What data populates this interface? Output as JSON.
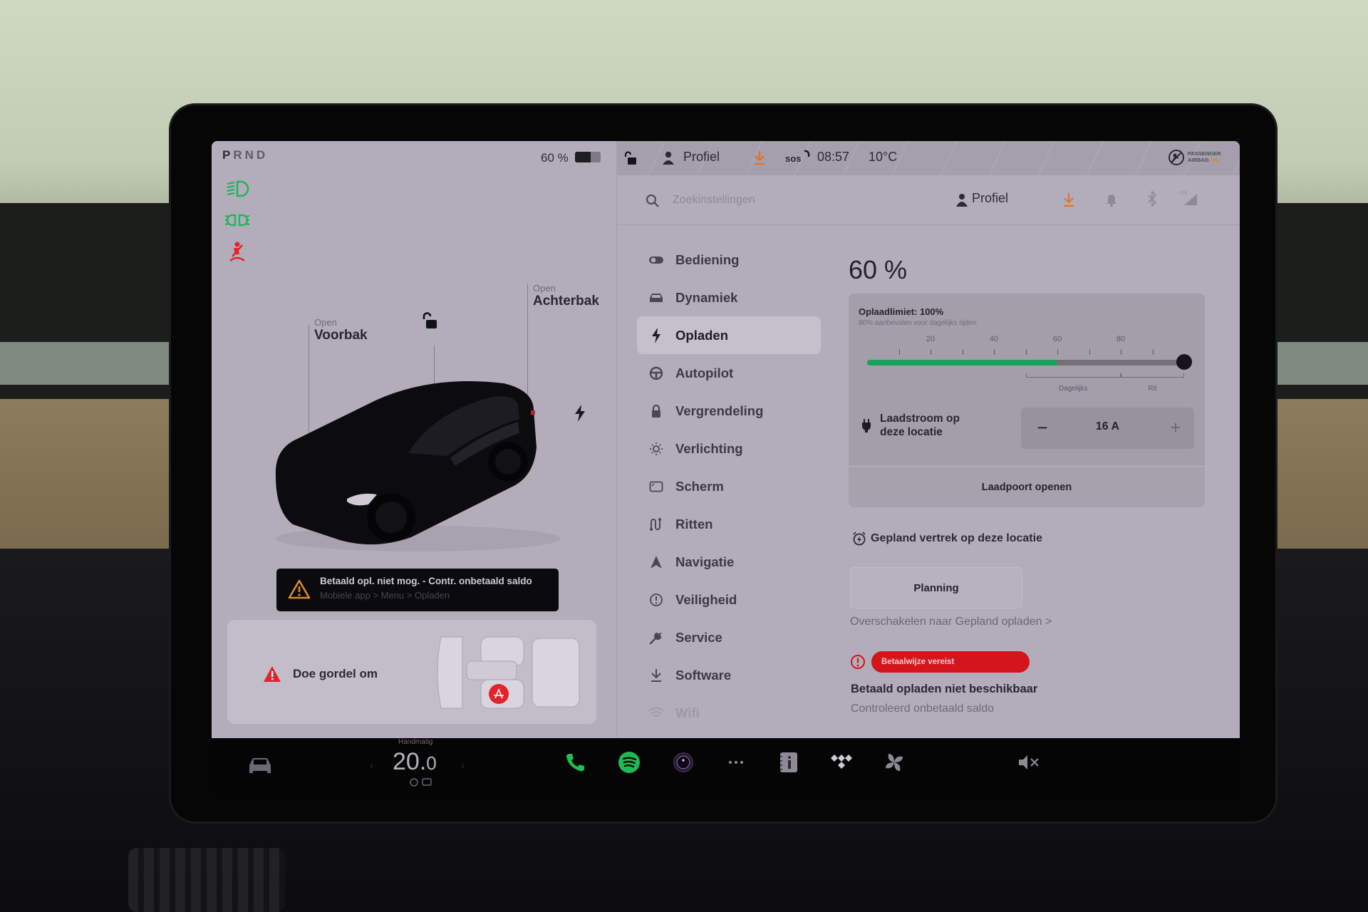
{
  "status_bar": {
    "gear": {
      "selected": "P",
      "others": "RND"
    },
    "battery_percent": "60 %",
    "battery_level": 0.6,
    "profile": "Profiel",
    "sos": "sos",
    "time": "08:57",
    "temperature": "10°C",
    "airbag": {
      "line1": "PASSENGER",
      "line2": "AIRBAG",
      "state": "ON"
    }
  },
  "telltales": [
    "low-beam-headlight",
    "parking-lights",
    "seatbelt-warning"
  ],
  "vehicle": {
    "frunk": {
      "state": "Open",
      "label": "Voorbak"
    },
    "trunk": {
      "state": "Open",
      "label": "Achterbak"
    },
    "lock_state": "unlocked"
  },
  "alert": {
    "title": "Betaald opl. niet mog. - Contr. onbetaald saldo",
    "path": "Mobiele app > Menu > Opladen"
  },
  "seatbelt_card": {
    "label": "Doe gordel om"
  },
  "settings": {
    "search_placeholder": "Zoekinstellingen",
    "profile": "Profiel",
    "nav": [
      {
        "label": "Bediening",
        "icon": "toggle-icon"
      },
      {
        "label": "Dynamiek",
        "icon": "car-front-icon"
      },
      {
        "label": "Opladen",
        "icon": "lightning-icon",
        "active": true
      },
      {
        "label": "Autopilot",
        "icon": "steering-wheel-icon"
      },
      {
        "label": "Vergrendeling",
        "icon": "lock-icon"
      },
      {
        "label": "Verlichting",
        "icon": "sun-icon"
      },
      {
        "label": "Scherm",
        "icon": "display-icon"
      },
      {
        "label": "Ritten",
        "icon": "trips-icon"
      },
      {
        "label": "Navigatie",
        "icon": "navigation-arrow-icon"
      },
      {
        "label": "Veiligheid",
        "icon": "info-circle-icon"
      },
      {
        "label": "Service",
        "icon": "wrench-icon"
      },
      {
        "label": "Software",
        "icon": "download-icon"
      },
      {
        "label": "Wifi",
        "icon": "wifi-icon"
      }
    ]
  },
  "charging": {
    "current_percent": "60 %",
    "limit_title": "Oplaadlimiet: 100%",
    "limit_hint": "80% aanbevolen voor dagelijks rijden",
    "scale_labels": [
      "20",
      "40",
      "60",
      "80"
    ],
    "battery_level_percent": 60,
    "charge_limit_percent": 100,
    "daily_label": "Dagelijks",
    "trip_label": "Rit",
    "amp_label_line1": "Laadstroom op",
    "amp_label_line2": "deze locatie",
    "amps": "16 A",
    "minus": "−",
    "plus": "+",
    "port_button": "Laadpoort openen",
    "departure_label": "Gepland vertrek op deze locatie",
    "planning_button": "Planning",
    "switch_link": "Overschakelen naar Gepland opladen >",
    "payment_badge": "Betaalwijze vereist",
    "payment_title": "Betaald opladen niet beschikbaar",
    "payment_sub": "Controleerd onbetaald saldo"
  },
  "dock": {
    "climate_mode": "Handmatig",
    "temp_int": "20.",
    "temp_dec": "0",
    "accent_green": "#1db954"
  }
}
